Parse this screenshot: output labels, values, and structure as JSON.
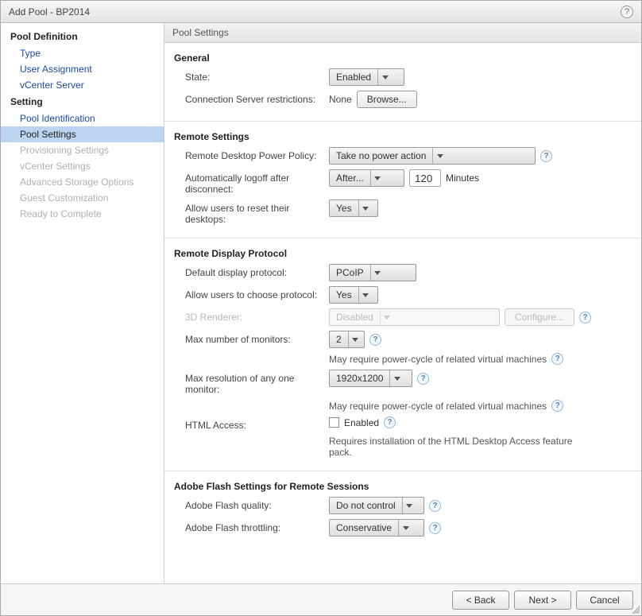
{
  "window": {
    "title": "Add Pool - BP2014"
  },
  "sidebar": {
    "pool_definition": "Pool Definition",
    "type": "Type",
    "user_assignment": "User Assignment",
    "vcenter_server": "vCenter Server",
    "setting": "Setting",
    "pool_identification": "Pool Identification",
    "pool_settings": "Pool Settings",
    "provisioning_settings": "Provisioning Settings",
    "vcenter_settings": "vCenter Settings",
    "advanced_storage_options": "Advanced Storage Options",
    "guest_customization": "Guest Customization",
    "ready_to_complete": "Ready to Complete"
  },
  "main": {
    "header": "Pool Settings",
    "general": {
      "title": "General",
      "state_label": "State:",
      "state_value": "Enabled",
      "conn_restrict_label": "Connection Server restrictions:",
      "conn_restrict_value": "None",
      "browse": "Browse..."
    },
    "remote": {
      "title": "Remote Settings",
      "power_label": "Remote Desktop Power Policy:",
      "power_value": "Take no power action",
      "logoff_label": "Automatically logoff after disconnect:",
      "logoff_select": "After...",
      "logoff_minutes": "120",
      "logoff_unit": "Minutes",
      "reset_label": "Allow users to reset their desktops:",
      "reset_value": "Yes"
    },
    "display": {
      "title": "Remote Display Protocol",
      "default_proto_label": "Default display protocol:",
      "default_proto_value": "PCoIP",
      "choose_label": "Allow users to choose protocol:",
      "choose_value": "Yes",
      "renderer_label": "3D Renderer:",
      "renderer_value": "Disabled",
      "configure": "Configure...",
      "monitors_label": "Max number of monitors:",
      "monitors_value": "2",
      "monitors_note": "May require power-cycle of related virtual machines",
      "maxres_label": "Max resolution of any one monitor:",
      "maxres_value": "1920x1200",
      "maxres_note": "May require power-cycle of related virtual machines",
      "html_label": "HTML Access:",
      "html_check_text": "Enabled",
      "html_note": "Requires installation of the HTML Desktop Access feature pack."
    },
    "flash": {
      "title": "Adobe Flash Settings for Remote Sessions",
      "quality_label": "Adobe Flash quality:",
      "quality_value": "Do not control",
      "throttle_label": "Adobe Flash throttling:",
      "throttle_value": "Conservative"
    }
  },
  "footer": {
    "back": "< Back",
    "next": "Next >",
    "cancel": "Cancel"
  }
}
